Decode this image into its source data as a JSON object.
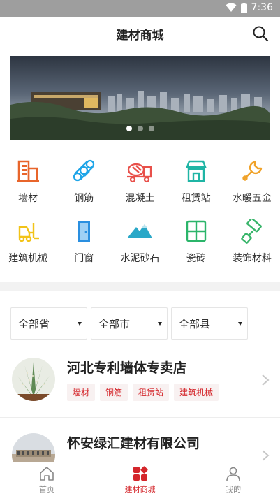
{
  "status_bar": {
    "time": "7:36"
  },
  "app_bar": {
    "title": "建材商城",
    "search_icon": "search-icon"
  },
  "banner": {
    "slide_count": 3,
    "active_slide": 1
  },
  "categories": [
    {
      "label": "墙材",
      "icon": "wall-material-icon",
      "color": "#e8652b"
    },
    {
      "label": "钢筋",
      "icon": "steel-bar-icon",
      "color": "#1ea5e8"
    },
    {
      "label": "混凝土",
      "icon": "concrete-mixer-icon",
      "color": "#e8504a"
    },
    {
      "label": "租赁站",
      "icon": "rental-station-icon",
      "color": "#1fb5a5"
    },
    {
      "label": "水暖五金",
      "icon": "wrench-icon",
      "color": "#f0a229"
    },
    {
      "label": "建筑机械",
      "icon": "forklift-icon",
      "color": "#f2c318"
    },
    {
      "label": "门窗",
      "icon": "door-icon",
      "color": "#2a8fe0"
    },
    {
      "label": "水泥砂石",
      "icon": "mountain-icon",
      "color": "#2aa8c8"
    },
    {
      "label": "瓷砖",
      "icon": "tile-icon",
      "color": "#2bb56a"
    },
    {
      "label": "装饰材料",
      "icon": "paint-roller-icon",
      "color": "#39b56b"
    }
  ],
  "filters": [
    {
      "label": "全部省"
    },
    {
      "label": "全部市"
    },
    {
      "label": "全部县"
    }
  ],
  "shops": [
    {
      "name": "河北专利墙体专卖店",
      "tags": [
        "墙材",
        "钢筋",
        "租赁站",
        "建筑机械"
      ]
    },
    {
      "name": "怀安绿汇建材有限公司",
      "tags": []
    }
  ],
  "tab_bar": [
    {
      "label": "首页",
      "icon": "home-icon",
      "active": false
    },
    {
      "label": "建材商城",
      "icon": "mall-grid-icon",
      "active": true
    },
    {
      "label": "我的",
      "icon": "person-icon",
      "active": false
    }
  ],
  "colors": {
    "accent": "#d4262b",
    "tag_bg": "#f8f1f1",
    "status_bar": "#9e9e9e"
  }
}
